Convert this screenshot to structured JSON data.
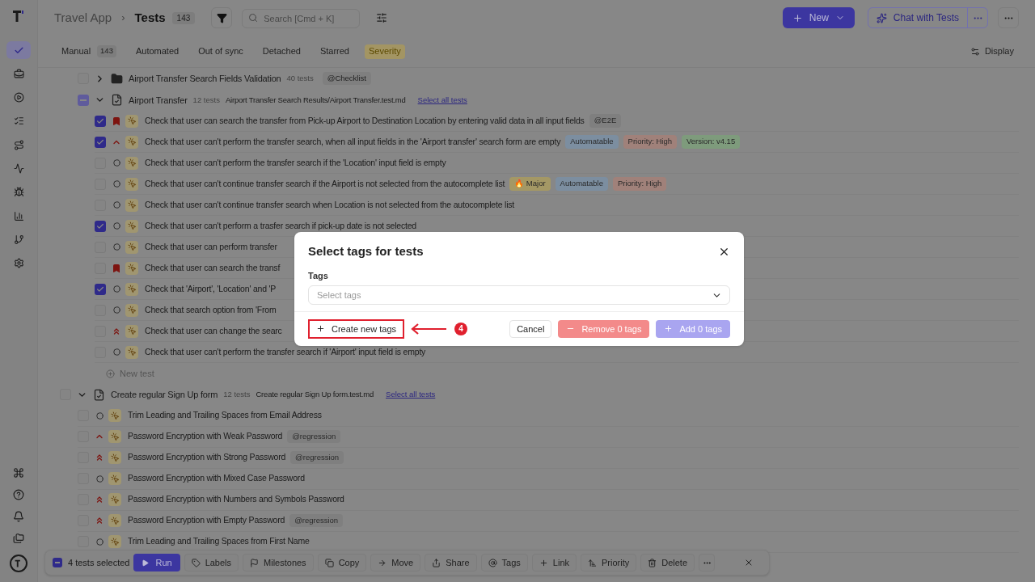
{
  "header": {
    "project": "Travel App",
    "separator": "›",
    "title": "Tests",
    "count": "143",
    "search_placeholder": "Search [Cmd + K]",
    "new_button": "New",
    "chat_button": "Chat with Tests"
  },
  "tabs": [
    {
      "label": "Manual",
      "count": "143",
      "selected": false,
      "highlighted": false
    },
    {
      "label": "Automated",
      "selected": false,
      "highlighted": false
    },
    {
      "label": "Out of sync",
      "selected": false,
      "highlighted": false
    },
    {
      "label": "Detached",
      "selected": false,
      "highlighted": false
    },
    {
      "label": "Starred",
      "selected": false,
      "highlighted": false
    },
    {
      "label": "Severity",
      "selected": false,
      "highlighted": true
    }
  ],
  "display_button": "Display",
  "suites": [
    {
      "kind": "folder",
      "name": "Airport Transfer Search Fields Validation",
      "count": "40 tests",
      "tag": "@Checklist",
      "expanded": false,
      "checked": false,
      "indeterminate": false
    },
    {
      "kind": "file",
      "name": "Airport Transfer",
      "count": "12 tests",
      "path": "Airport Transfer Search Results/Airport Transfer.test.md",
      "select_all": "Select all tests",
      "expanded": true,
      "checked": false,
      "indeterminate": true,
      "new_test": "New test",
      "tests": [
        {
          "title": "Check that user can search the transfer from Pick-up Airport to Destination Location by entering valid data in all input fields",
          "checked": true,
          "kind": "bookmark",
          "tags": [
            {
              "label": "@E2E",
              "color": "#7f7f7f"
            }
          ]
        },
        {
          "title": "Check that user can't perform the transfer search, when all input fields in the 'Airport transfer' search form are empty",
          "checked": true,
          "kind": "high",
          "tags": [
            {
              "label": "Automatable",
              "color": "#7c8ea0"
            },
            {
              "label": "Priority: High",
              "color": "#a0817a"
            },
            {
              "label": "Version: v4.15",
              "color": "#7e9b7c"
            }
          ]
        },
        {
          "title": "Check that user can't perform the transfer search if the 'Location' input field is empty",
          "checked": false,
          "kind": "normal"
        },
        {
          "title": "Check that user can't continue transfer search if the Airport is not selected from the autocomplete list",
          "checked": false,
          "kind": "normal",
          "tags": [
            {
              "label": "🔥 Major",
              "color": "#a49865"
            },
            {
              "label": "Automatable",
              "color": "#7c8ea0"
            },
            {
              "label": "Priority: High",
              "color": "#a0817a"
            }
          ]
        },
        {
          "title": "Check that user can't continue transfer search when Location is not selected from the autocomplete list",
          "checked": false,
          "kind": "normal"
        },
        {
          "title": "Check that user can't perform a trasfer search if pick-up date is not selected",
          "checked": true,
          "kind": "normal"
        },
        {
          "title": "Check that user can perform transfer",
          "checked": false,
          "kind": "normal"
        },
        {
          "title": "Check that user can search the transf",
          "checked": false,
          "kind": "bookmark"
        },
        {
          "title": "Check that 'Airport', 'Location' and 'P",
          "checked": true,
          "kind": "normal"
        },
        {
          "title": "Check that search option from 'From",
          "checked": false,
          "kind": "normal"
        },
        {
          "title": "Check that user can change the searc",
          "checked": false,
          "kind": "critical"
        },
        {
          "title": "Check that user can't perform the transfer search if 'Airport' input field is empty",
          "checked": false,
          "kind": "normal"
        }
      ]
    }
  ],
  "signup_suite": {
    "name": "Create regular Sign Up form",
    "count": "12 tests",
    "path": "Create regular Sign Up form.test.md",
    "select_all": "Select all tests",
    "expanded": true,
    "checked": false,
    "indeterminate": false,
    "tests": [
      {
        "title": "Trim Leading and Trailing Spaces from Email Address",
        "checked": false,
        "kind": "normal"
      },
      {
        "title": "Password Encryption with Weak Password",
        "checked": false,
        "kind": "high",
        "tags": [
          {
            "label": "@regression",
            "color": "#7f7f7f"
          }
        ]
      },
      {
        "title": "Password Encryption with Strong Password",
        "checked": false,
        "kind": "critical",
        "tags": [
          {
            "label": "@regression",
            "color": "#7f7f7f"
          }
        ]
      },
      {
        "title": "Password Encryption with Mixed Case Password",
        "checked": false,
        "kind": "normal"
      },
      {
        "title": "Password Encryption with Numbers and Symbols Password",
        "checked": false,
        "kind": "critical"
      },
      {
        "title": "Password Encryption with Empty Password",
        "checked": false,
        "kind": "critical",
        "tags": [
          {
            "label": "@regression",
            "color": "#7f7f7f"
          }
        ]
      },
      {
        "title": "Trim Leading and Trailing Spaces from First Name",
        "checked": false,
        "kind": "normal"
      }
    ]
  },
  "action_bar": {
    "selected": "4 tests selected",
    "indeterminate": true,
    "run": "Run",
    "actions": [
      "Labels",
      "Milestones",
      "Copy",
      "Move",
      "Share",
      "Tags",
      "Link",
      "Priority",
      "Delete"
    ]
  },
  "dialog": {
    "title": "Select tags for tests",
    "field_label": "Tags",
    "placeholder": "Select tags",
    "create": "Create new tags",
    "cancel": "Cancel",
    "remove": "Remove 0 tags",
    "add": "Add 0 tags",
    "annotation": "4"
  }
}
